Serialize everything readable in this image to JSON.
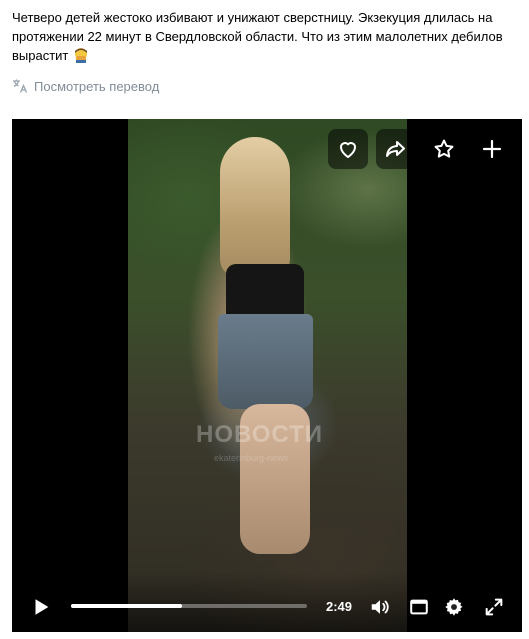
{
  "post": {
    "text": "Четверо детей жестоко избивают и унижают сверстницу. Экзекуция длилась на протяжении 22 минут в Свердловской области. Что из этим малолетних дебилов вырастит",
    "translate_label": "Посмотреть перевод"
  },
  "video": {
    "watermark": "НОВОСТИ",
    "watermark_sub": "ekaterinburg-news",
    "overlay_buttons": [
      "heart-icon",
      "share-icon",
      "star-icon",
      "plus-icon"
    ],
    "time": "2:49",
    "progress": 0.47
  },
  "colors": {
    "link_gray": "#818c99",
    "text": "#000000",
    "emoji_skin": "#f5c842"
  }
}
